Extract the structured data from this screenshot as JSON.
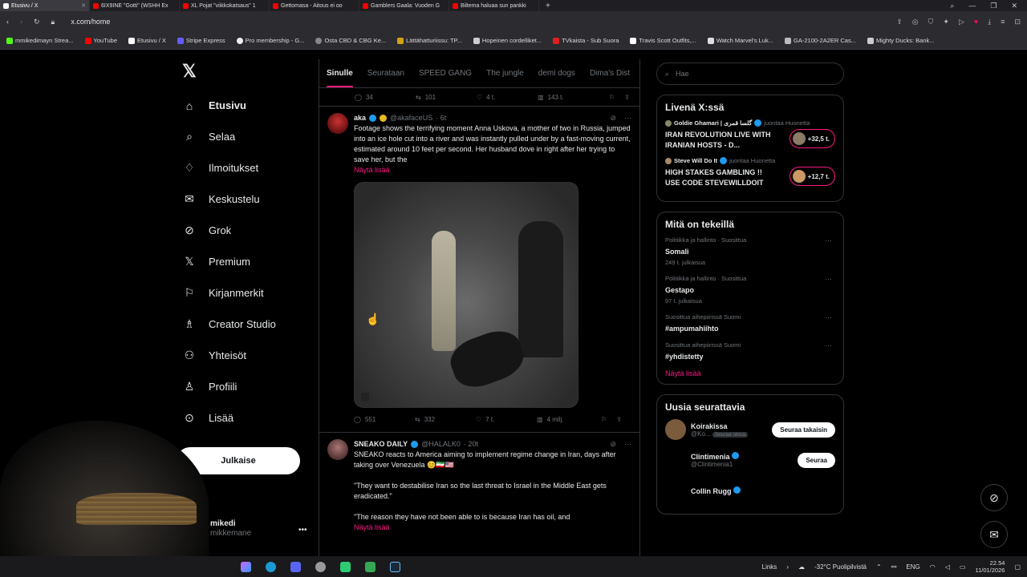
{
  "browser": {
    "tabs": [
      {
        "title": "Etusivu / X",
        "color": "#ffffff",
        "active": true
      },
      {
        "title": "6IX9INE \"Gotti\" (WSHH Ex",
        "color": "#ff0000"
      },
      {
        "title": "XL Pojat \"viikkokatsaus\" 1",
        "color": "#ff0000"
      },
      {
        "title": "Gettomasa - Aitous ei oo",
        "color": "#ff0000"
      },
      {
        "title": "Gamblers Gaala: Vuoden G",
        "color": "#ff0000"
      },
      {
        "title": "Biltema haluaa sun pankki",
        "color": "#ff0000"
      }
    ],
    "url": "x.com/home",
    "bookmarks": [
      {
        "label": "mmikedimayn Strea...",
        "color": "#53fc18"
      },
      {
        "label": "YouTube",
        "color": "#ff0000"
      },
      {
        "label": "Etusivu / X",
        "color": "#ffffff"
      },
      {
        "label": "Stripe Express",
        "color": "#635bff"
      },
      {
        "label": "Pro membership - G...",
        "color": "#e0e0e0"
      },
      {
        "label": "Osta CBD & CBG Ke...",
        "color": "#888888"
      },
      {
        "label": "Lättähatturiissu: TP...",
        "color": "#d4a017"
      },
      {
        "label": "Hopeinen cordelliket...",
        "color": "#cccccc"
      },
      {
        "label": "TVkaista - Sub Suora",
        "color": "#e02020"
      },
      {
        "label": "Travis Scott Outfits,...",
        "color": "#ffffff"
      },
      {
        "label": "Watch Marvel's Luk...",
        "color": "#dddddd"
      },
      {
        "label": "GA-2100-2A2ER Cas...",
        "color": "#bbbbbb"
      },
      {
        "label": "Mighty Ducks: Bank...",
        "color": "#cccccc"
      }
    ]
  },
  "nav": {
    "items": [
      {
        "label": "Etusivu",
        "icon": "home-icon",
        "glyph": "⌂",
        "active": true
      },
      {
        "label": "Selaa",
        "icon": "search-icon",
        "glyph": "⌕"
      },
      {
        "label": "Ilmoitukset",
        "icon": "bell-icon",
        "glyph": "♢"
      },
      {
        "label": "Keskustelu",
        "icon": "mail-icon",
        "glyph": "✉"
      },
      {
        "label": "Grok",
        "icon": "grok-icon",
        "glyph": "⊘"
      },
      {
        "label": "Premium",
        "icon": "x-icon",
        "glyph": "𝕏"
      },
      {
        "label": "Kirjanmerkit",
        "icon": "bookmark-icon",
        "glyph": "⚐"
      },
      {
        "label": "Creator Studio",
        "icon": "creator-icon",
        "glyph": "♗"
      },
      {
        "label": "Yhteisöt",
        "icon": "communities-icon",
        "glyph": "⚇"
      },
      {
        "label": "Profiili",
        "icon": "profile-icon",
        "glyph": "♙"
      },
      {
        "label": "Lisää",
        "icon": "more-icon",
        "glyph": "⊙"
      }
    ],
    "post_label": "Julkaise",
    "account": {
      "name": "mikedi",
      "handle": "mikkemane"
    }
  },
  "feed": {
    "tabs": [
      "Sinulle",
      "Seurataan",
      "SPEED GANG",
      "The jungle",
      "demi dogs",
      "Dima's Dist"
    ],
    "top_actions": {
      "replies": "34",
      "reposts": "101",
      "likes": "4 t.",
      "views": "143 t."
    },
    "tweets": [
      {
        "name": "aka",
        "handle": "@akafaceUS",
        "time": "· 6t",
        "text": "Footage shows the terrifying moment Anna Uskova, a mother of two in Russia, jumped into an ice hole cut into a river and was instantly pulled under by a fast-moving current, estimated around 10 feet per second. Her husband dove in right after her trying to save her, but the",
        "more": "Näytä lisää",
        "replies": "551",
        "reposts": "332",
        "likes": "7 t.",
        "views": "4 milj."
      },
      {
        "name": "SNEAKO DAILY",
        "handle": "@HALALK0",
        "time": "· 20t",
        "text1": "SNEAKO reacts to America aiming to implement regime change in Iran, days after taking over Venezuela 😊🇮🇷🇺🇸",
        "text2": "\"They want to destabilise Iran so the last threat to Israel in the Middle East gets eradicated.\"",
        "text3": "\"The reason they have not been able to is because Iran has oil, and",
        "more": "Näytä lisää"
      }
    ]
  },
  "sidebar": {
    "search_placeholder": "Hae",
    "live_title": "Livenä X:ssä",
    "live": [
      {
        "host": "Goldie Ghamari | گلسا قمری",
        "suffix": "juontaa Huonetta",
        "title": "IRAN REVOLUTION LIVE WITH IRANIAN HOSTS - D...",
        "count": "+32,5 t."
      },
      {
        "host": "Steve Will Do It",
        "suffix": "juontaa Huonetta",
        "title": "HIGH STAKES GAMBLING !! USE CODE STEVEWILLDOIT",
        "count": "+12,7 t."
      }
    ],
    "trends_title": "Mitä on tekeillä",
    "trends": [
      {
        "cat": "Politiikka ja hallinto · Suosittua",
        "name": "Somali",
        "count": "249 t. julkaisua"
      },
      {
        "cat": "Politiikka ja hallinto · Suosittua",
        "name": "Gestapo",
        "count": "97 t. julkaisua"
      },
      {
        "cat": "Suosittua aihepiirissä Suomi",
        "name": "#ampumahiihto",
        "count": ""
      },
      {
        "cat": "Suosittua aihepiirissä Suomi",
        "name": "#yhdistetty",
        "count": ""
      }
    ],
    "show_more": "Näytä lisää",
    "follow_title": "Uusia seurattavia",
    "follow": [
      {
        "name": "Koirakissa",
        "handle": "@Ko...",
        "tag": "Seuraa sinua",
        "button": "Seuraa takaisin"
      },
      {
        "name": "Clintimenia",
        "handle": "@Clintimenia1",
        "button": "Seuraa"
      },
      {
        "name": "Collin Rugg",
        "handle": "",
        "button": ""
      }
    ]
  },
  "taskbar": {
    "links": "Links",
    "weather": "-32°C  Puolipilvistä",
    "lang": "ENG",
    "time": "22.54",
    "date": "11/01/2026"
  },
  "colors": {
    "accent": "#f91880",
    "verified": "#1d9bf0",
    "gold": "#e8b923"
  }
}
